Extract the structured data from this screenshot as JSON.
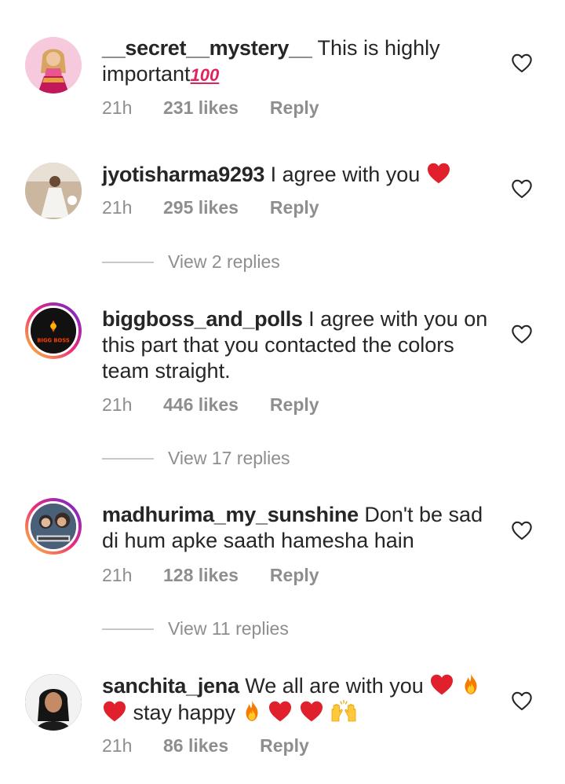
{
  "comments": [
    {
      "username": "__secret__mystery__",
      "text": "This is highly important",
      "emoji_text": "100",
      "time": "21h",
      "likes": "231 likes",
      "reply": "Reply"
    },
    {
      "username": "jyotisharma9293",
      "text": "I agree with you",
      "time": "21h",
      "likes": "295 likes",
      "reply": "Reply",
      "view_replies": "View 2 replies"
    },
    {
      "username": "biggboss_and_polls",
      "text": "I agree with you on this part that you contacted the colors team straight.",
      "avatar_text": "BIGG BOSS",
      "time": "21h",
      "likes": "446 likes",
      "reply": "Reply",
      "view_replies": "View 17 replies"
    },
    {
      "username": "madhurima_my_sunshine",
      "text": "Don't be sad di hum apke saath hamesha hain",
      "time": "21h",
      "likes": "128 likes",
      "reply": "Reply",
      "view_replies": "View 11 replies"
    },
    {
      "username": "sanchita_jena",
      "text": "We all are with you",
      "text2": "stay happy",
      "time": "21h",
      "likes": "86 likes",
      "reply": "Reply"
    }
  ],
  "icons": {
    "like": "heart-outline-icon",
    "red_heart": "red-heart-emoji",
    "fire": "fire-emoji",
    "raised_hands": "raised-hands-emoji"
  },
  "colors": {
    "text": "#262626",
    "meta": "#8e8e8e",
    "emoji_red": "#e0202c"
  }
}
